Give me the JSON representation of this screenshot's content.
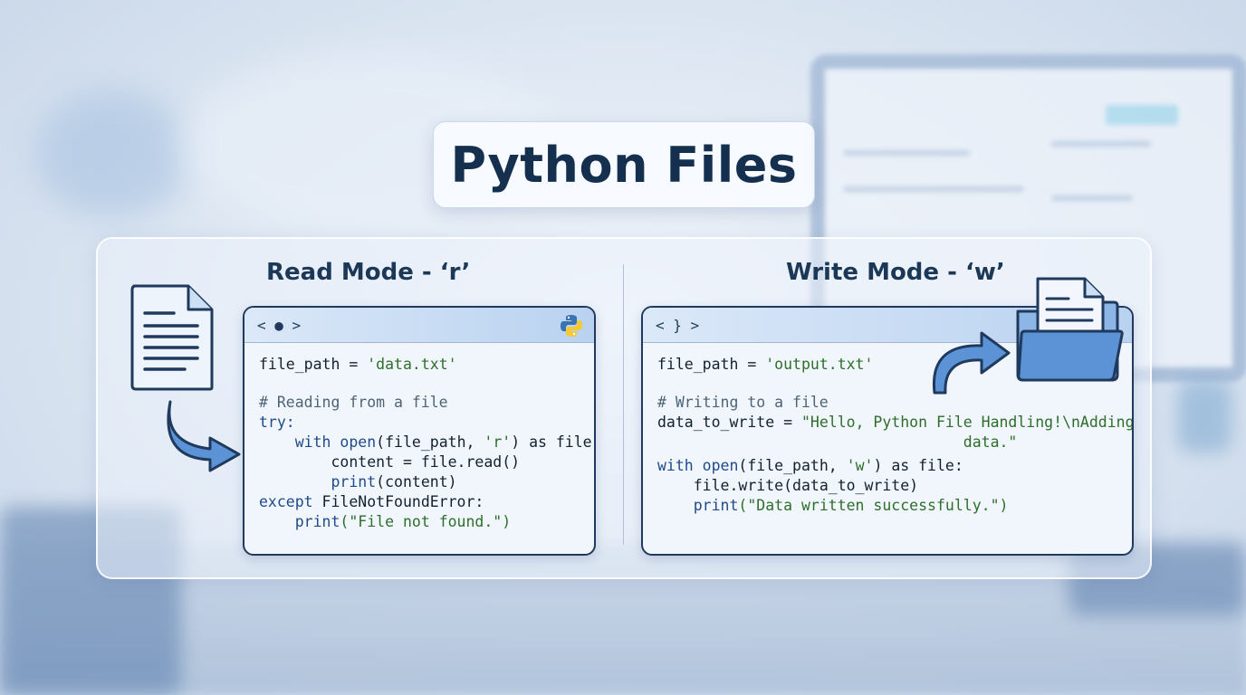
{
  "title": "Python Files",
  "read": {
    "label": "Read Mode - ‘r’",
    "bar_glyph": "< ● >",
    "code": {
      "l1_var": "file_path = ",
      "l1_str": "'data.txt'",
      "l2_comment": "# Reading from a file",
      "l3_kw": "try:",
      "l4_kw": "with ",
      "l4_fn": "open",
      "l4_mid": "(file_path, ",
      "l4_str": "'r'",
      "l4_end": ") as file:",
      "l5": "content = file.read()",
      "l6_fn": "print",
      "l6_rest": "(content)",
      "l7_kw": "except ",
      "l7_rest": "FileNotFoundError:",
      "l8_fn": "print",
      "l8_str": "(\"File not found.\")"
    }
  },
  "write": {
    "label": "Write Mode - ‘w’",
    "bar_glyph": "< } >",
    "code": {
      "l1_var": "file_path = ",
      "l1_str": "'output.txt'",
      "l2_comment": "# Writing to a file",
      "l3_var": "data_to_write = ",
      "l3_str": "\"Hello, Python File Handling!\\nAdding new",
      "l3_cont": "data.\"",
      "l4_kw": "with ",
      "l4_fn": "open",
      "l4_mid": "(file_path, ",
      "l4_str": "'w'",
      "l4_end": ") as file:",
      "l5": "file.write(data_to_write)",
      "l6_fn": "print",
      "l6_str": "(\"Data written successfully.\")"
    }
  },
  "icons": [
    "document-icon",
    "arrow-right-icon",
    "python-logo-icon",
    "folder-icon",
    "arrow-curve-icon"
  ],
  "colors": {
    "title_text": "#15304f",
    "keyword": "#1f4a8a",
    "string": "#2e6e2b",
    "comment": "#4e6476",
    "window_border": "#1f3a5c"
  }
}
